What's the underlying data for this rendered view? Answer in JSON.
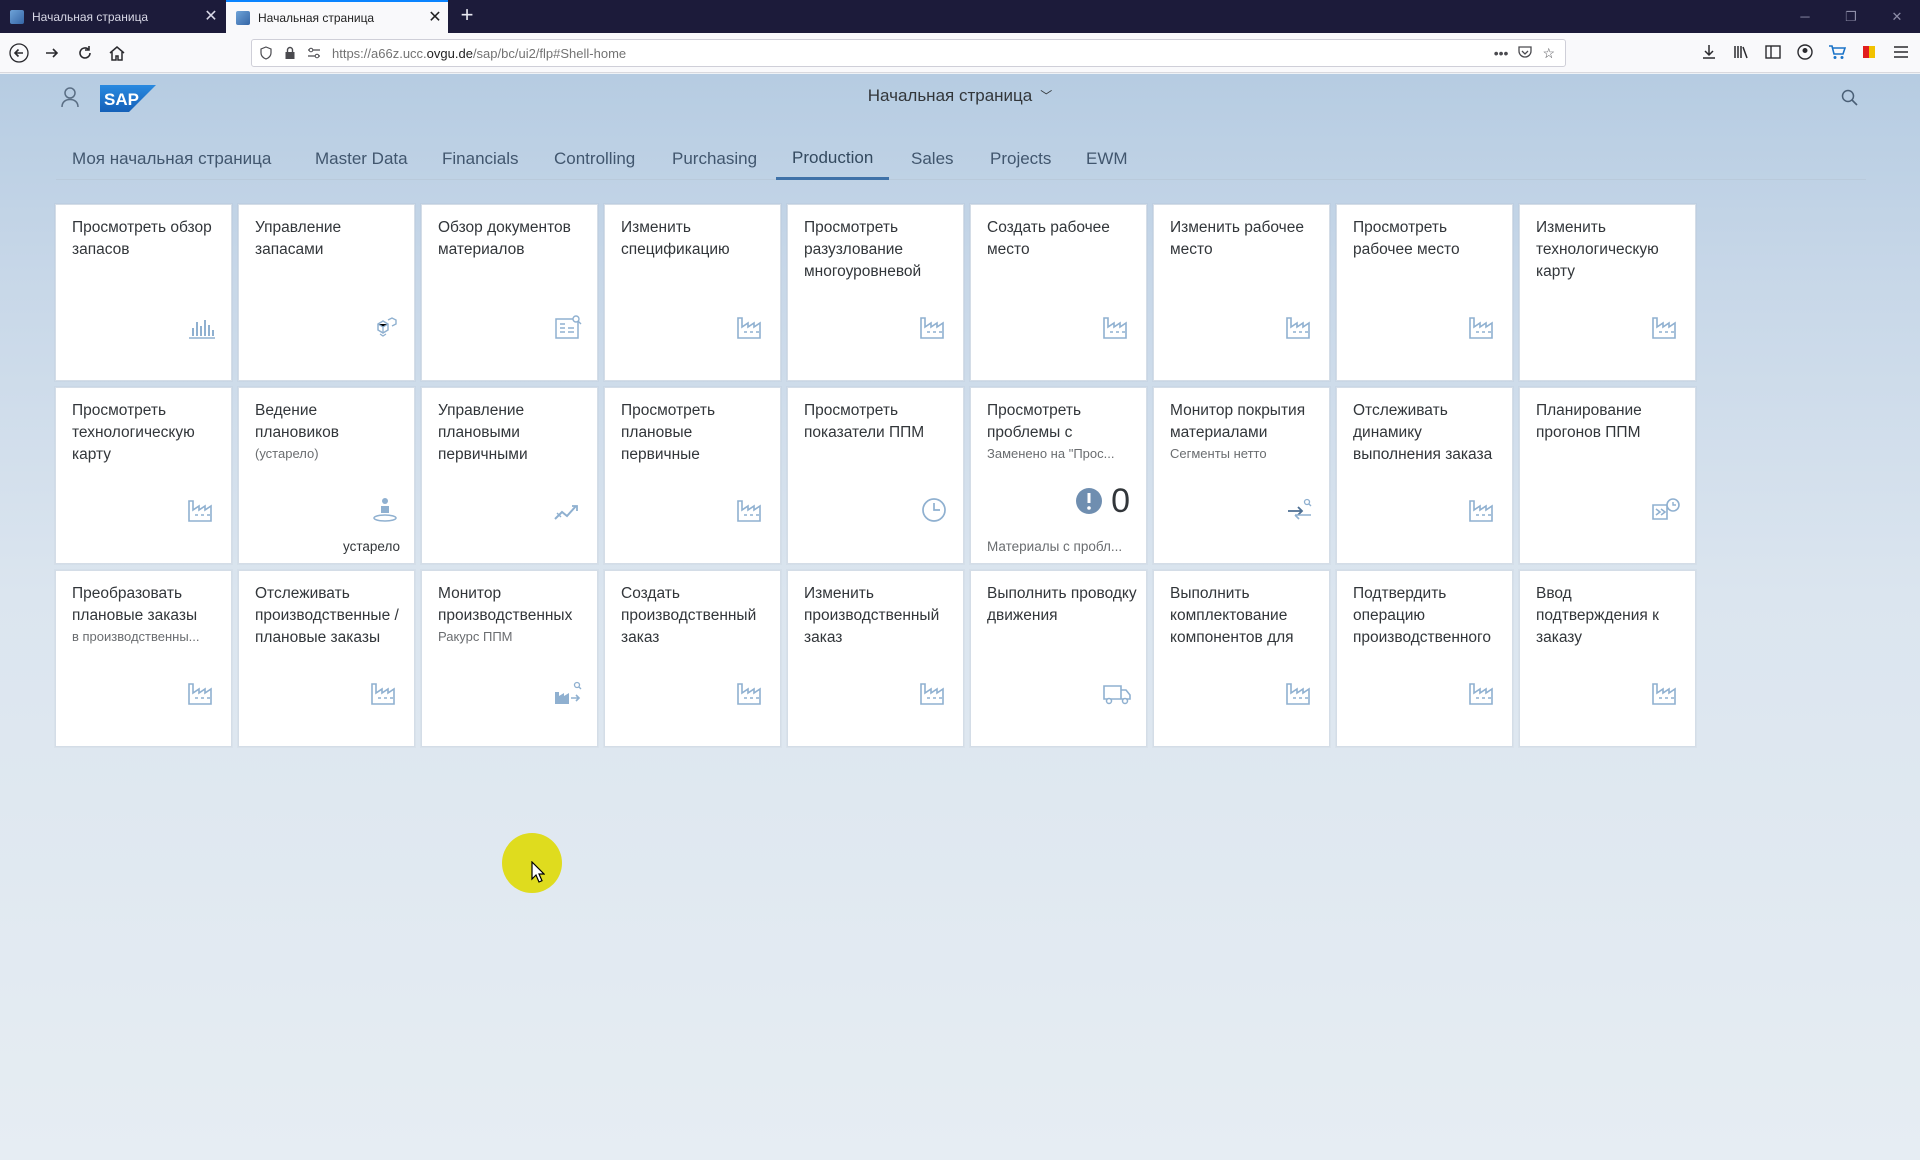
{
  "browser": {
    "tabs": [
      {
        "title": "Начальная страница",
        "active": false
      },
      {
        "title": "Начальная страница",
        "active": true
      }
    ],
    "new_tab_label": "+",
    "url_prefix": "https://a66z.ucc.",
    "url_host": "ovgu.de",
    "url_path": "/sap/bc/ui2/flp#Shell-home",
    "window_controls": [
      "minimize",
      "restore",
      "close"
    ]
  },
  "shell": {
    "title": "Начальная страница",
    "brand": "SAP",
    "group_tabs": [
      {
        "label": "Моя начальная страница",
        "active": false
      },
      {
        "label": "Master Data",
        "active": false
      },
      {
        "label": "Financials",
        "active": false
      },
      {
        "label": "Controlling",
        "active": false
      },
      {
        "label": "Purchasing",
        "active": false
      },
      {
        "label": "Production",
        "active": true
      },
      {
        "label": "Sales",
        "active": false
      },
      {
        "label": "Projects",
        "active": false
      },
      {
        "label": "EWM",
        "active": false
      }
    ]
  },
  "tiles": [
    {
      "title": "Просмотреть обзор запасов",
      "icon": "bar-chart-icon"
    },
    {
      "title": "Управление запасами",
      "icon": "cubes-icon"
    },
    {
      "title": "Обзор документов материалов",
      "icon": "document-search-icon"
    },
    {
      "title": "Изменить спецификацию",
      "icon": "factory-icon"
    },
    {
      "title": "Просмотреть разузлование многоуровневой",
      "icon": "factory-icon"
    },
    {
      "title": "Создать рабочее место",
      "icon": "factory-icon"
    },
    {
      "title": "Изменить рабочее место",
      "icon": "factory-icon"
    },
    {
      "title": "Просмотреть рабочее место",
      "icon": "factory-icon"
    },
    {
      "title": "Изменить технологическую карту",
      "icon": "factory-icon"
    },
    {
      "title": "Просмотреть технологическую карту",
      "icon": "factory-icon"
    },
    {
      "title": "Ведение плановиков",
      "subtitle": "(устарело)",
      "icon": "person-place-icon",
      "footer": "устарело"
    },
    {
      "title": "Управление плановыми первичными",
      "icon": "trend-icon"
    },
    {
      "title": "Просмотреть плановые первичные",
      "icon": "factory-icon"
    },
    {
      "title": "Просмотреть показатели ППМ",
      "icon": "clock-icon"
    },
    {
      "title": "Просмотреть проблемы с",
      "subtitle": "Заменено на \"Прос...",
      "kpi": "0",
      "kpi_icon": "alert-icon",
      "footer_left": "Материалы с пробл..."
    },
    {
      "title": "Монитор покрытия материалами",
      "subtitle": "Сегменты нетто",
      "icon": "transfer-icon"
    },
    {
      "title": "Отслеживать динамику выполнения заказа",
      "icon": "factory-icon"
    },
    {
      "title": "Планирование прогонов ППМ",
      "icon": "schedule-run-icon"
    },
    {
      "title": "Преобразовать плановые заказы",
      "subtitle": "в производственны...",
      "icon": "factory-icon"
    },
    {
      "title": "Отслеживать производственные / плановые заказы",
      "icon": "factory-icon"
    },
    {
      "title": "Монитор производственных",
      "subtitle": "Ракурс ППМ",
      "icon": "factory-monitor-icon"
    },
    {
      "title": "Создать производственный заказ",
      "icon": "factory-icon"
    },
    {
      "title": "Изменить производственный заказ",
      "icon": "factory-icon"
    },
    {
      "title": "Выполнить проводку движения",
      "icon": "truck-icon"
    },
    {
      "title": "Выполнить комплектование компонентов для",
      "icon": "factory-icon"
    },
    {
      "title": "Подтвердить операцию производственного",
      "icon": "factory-icon"
    },
    {
      "title": "Ввод подтверждения к заказу",
      "icon": "factory-icon"
    }
  ],
  "colors": {
    "shell_gradient_top": "#b6cce2",
    "active_tab_underline": "#3f72a8",
    "tile_icon": "#8fb0d0",
    "sap_blue": "#1d6ec6"
  }
}
